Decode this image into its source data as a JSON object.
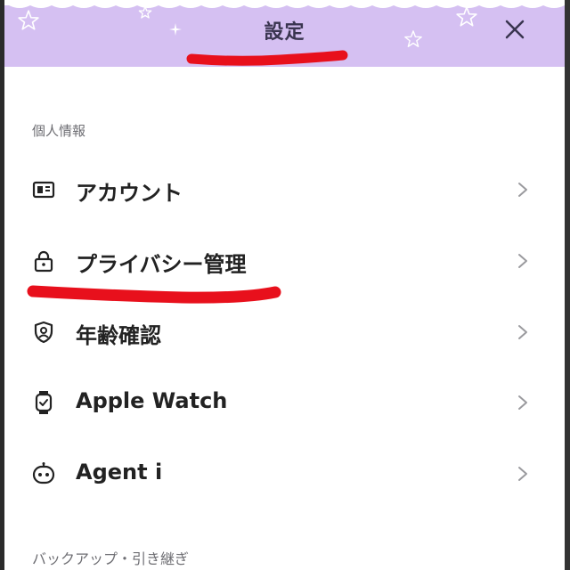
{
  "header": {
    "title": "設定",
    "close_icon": "close-icon",
    "background_color": "#d5c0f2"
  },
  "sections": [
    {
      "label": "個人情報",
      "items": [
        {
          "label": "アカウント",
          "icon": "id-card-icon"
        },
        {
          "label": "プライバシー管理",
          "icon": "lock-icon"
        },
        {
          "label": "年齢確認",
          "icon": "shield-user-icon"
        },
        {
          "label": "Apple Watch",
          "icon": "watch-icon"
        },
        {
          "label": "Agent i",
          "icon": "robot-icon"
        }
      ]
    },
    {
      "label": "バックアップ・引き継ぎ",
      "items": []
    }
  ],
  "annotation_color": "#e8101c"
}
